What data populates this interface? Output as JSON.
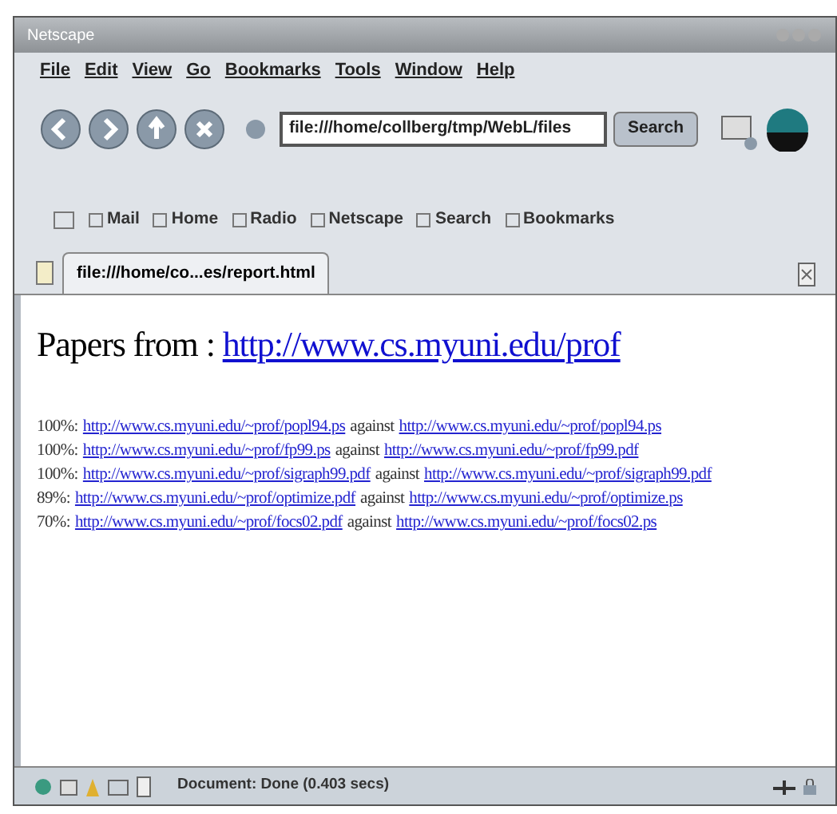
{
  "window": {
    "title": "Netscape"
  },
  "menu": [
    "File",
    "Edit",
    "View",
    "Go",
    "Bookmarks",
    "Tools",
    "Window",
    "Help"
  ],
  "address": {
    "value": "file:///home/collberg/tmp/WebL/files"
  },
  "search_button": "Search",
  "personal_toolbar": [
    "Mail",
    "Home",
    "Radio",
    "Netscape",
    "Search",
    "Bookmarks"
  ],
  "tabs": [
    {
      "label": "file:///home/co...es/report.html",
      "selected": true
    }
  ],
  "page": {
    "heading": "Papers from : ",
    "heading_link": "http://www.cs.myuni.edu/prof",
    "rows": [
      {
        "score": "100%:",
        "left": "http://www.cs.myuni.edu/~prof/popl94.ps",
        "sep": "against",
        "right": "http://www.cs.myuni.edu/~prof/popl94.ps"
      },
      {
        "score": "100%:",
        "left": "http://www.cs.myuni.edu/~prof/fp99.ps",
        "sep": "against",
        "right": "http://www.cs.myuni.edu/~prof/fp99.pdf"
      },
      {
        "score": "100%:",
        "left": "http://www.cs.myuni.edu/~prof/sigraph99.pdf",
        "sep": "against",
        "right": "http://www.cs.myuni.edu/~prof/sigraph99.pdf"
      },
      {
        "score": "89%:",
        "left": "http://www.cs.myuni.edu/~prof/optimize.pdf",
        "sep": "against",
        "right": "http://www.cs.myuni.edu/~prof/optimize.ps"
      },
      {
        "score": "70%:",
        "left": "http://www.cs.myuni.edu/~prof/focs02.pdf",
        "sep": "against",
        "right": "http://www.cs.myuni.edu/~prof/focs02.ps"
      }
    ]
  },
  "status_bar": {
    "text": "Document: Done (0.403 secs)"
  }
}
